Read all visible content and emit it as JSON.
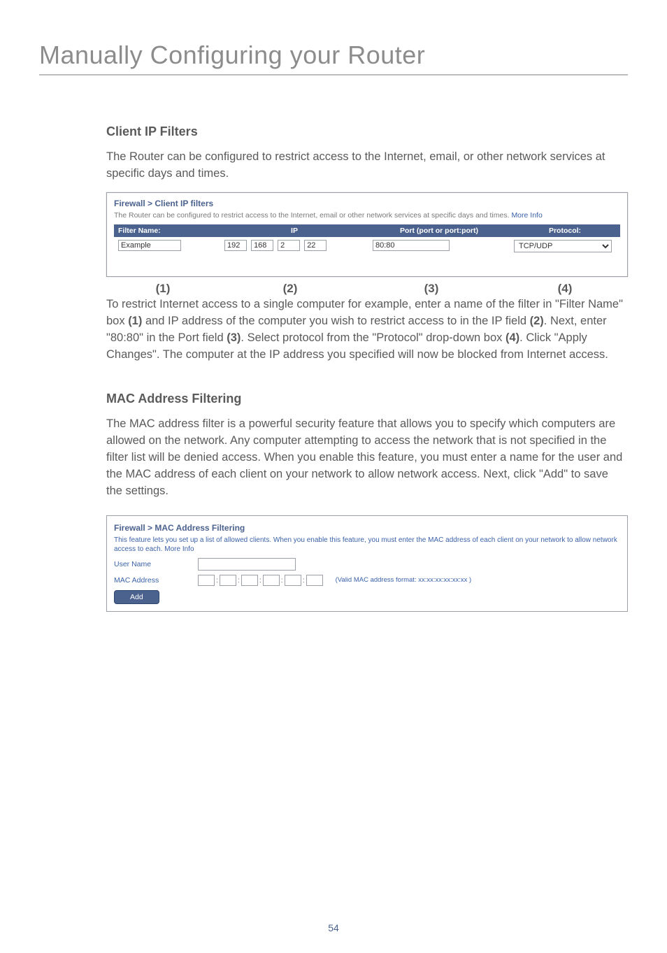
{
  "page_title": "Manually Configuring your Router",
  "page_number": "54",
  "section1": {
    "heading": "Client IP Filters",
    "intro": "The Router can be configured to restrict access to the Internet, email, or other network services at specific days and times.",
    "desc_a": "To restrict Internet access to a single computer for example, enter a name of the filter in \"Filter Name\" box ",
    "m1": "(1)",
    "desc_b": " and IP address of the computer you wish to restrict access to in the IP field ",
    "m2": "(2)",
    "desc_c": ". Next, enter \"80:80\" in the Port field ",
    "m3": "(3)",
    "desc_d": ". Select protocol from the \"Protocol\" drop-down box ",
    "m4": "(4)",
    "desc_e": ". Click \"Apply Changes\". The computer at the IP address you specified will now be blocked from Internet access."
  },
  "ipfilter": {
    "breadcrumb": "Firewall > Client IP filters",
    "desc": "The Router can be configured to restrict access to the Internet, email or other network services at specific days and times. ",
    "more_info": "More Info",
    "headers": {
      "name": "Filter Name:",
      "ip": "IP",
      "port": "Port (port or port:port)",
      "proto": "Protocol:"
    },
    "row": {
      "filter_name": "Example",
      "ip1": "192",
      "ip2": "168",
      "ip3": "2",
      "ip4": "22",
      "port": "80:80",
      "protocol": "TCP/UDP"
    },
    "markers": {
      "m1": "(1)",
      "m2": "(2)",
      "m3": "(3)",
      "m4": "(4)"
    }
  },
  "section2": {
    "heading": "MAC Address Filtering",
    "body": "The MAC address filter is a powerful security feature that allows you to specify which computers are allowed on the network. Any computer attempting to access the network that is not specified in the filter list will be denied access. When you enable this feature, you must enter a name for the user and the MAC address of each client on your network to allow network access. Next, click \"Add\" to save the settings."
  },
  "macbox": {
    "breadcrumb": "Firewall > MAC Address Filtering",
    "desc": "This feature lets you set up a list of allowed clients. When you enable this feature, you must enter the MAC address of each client on your network to allow network access to each. ",
    "more_info": "More Info",
    "user_label": "User Name",
    "mac_label": "MAC Address",
    "hint": "(Valid MAC address format: xx:xx:xx:xx:xx:xx )",
    "add": "Add"
  }
}
